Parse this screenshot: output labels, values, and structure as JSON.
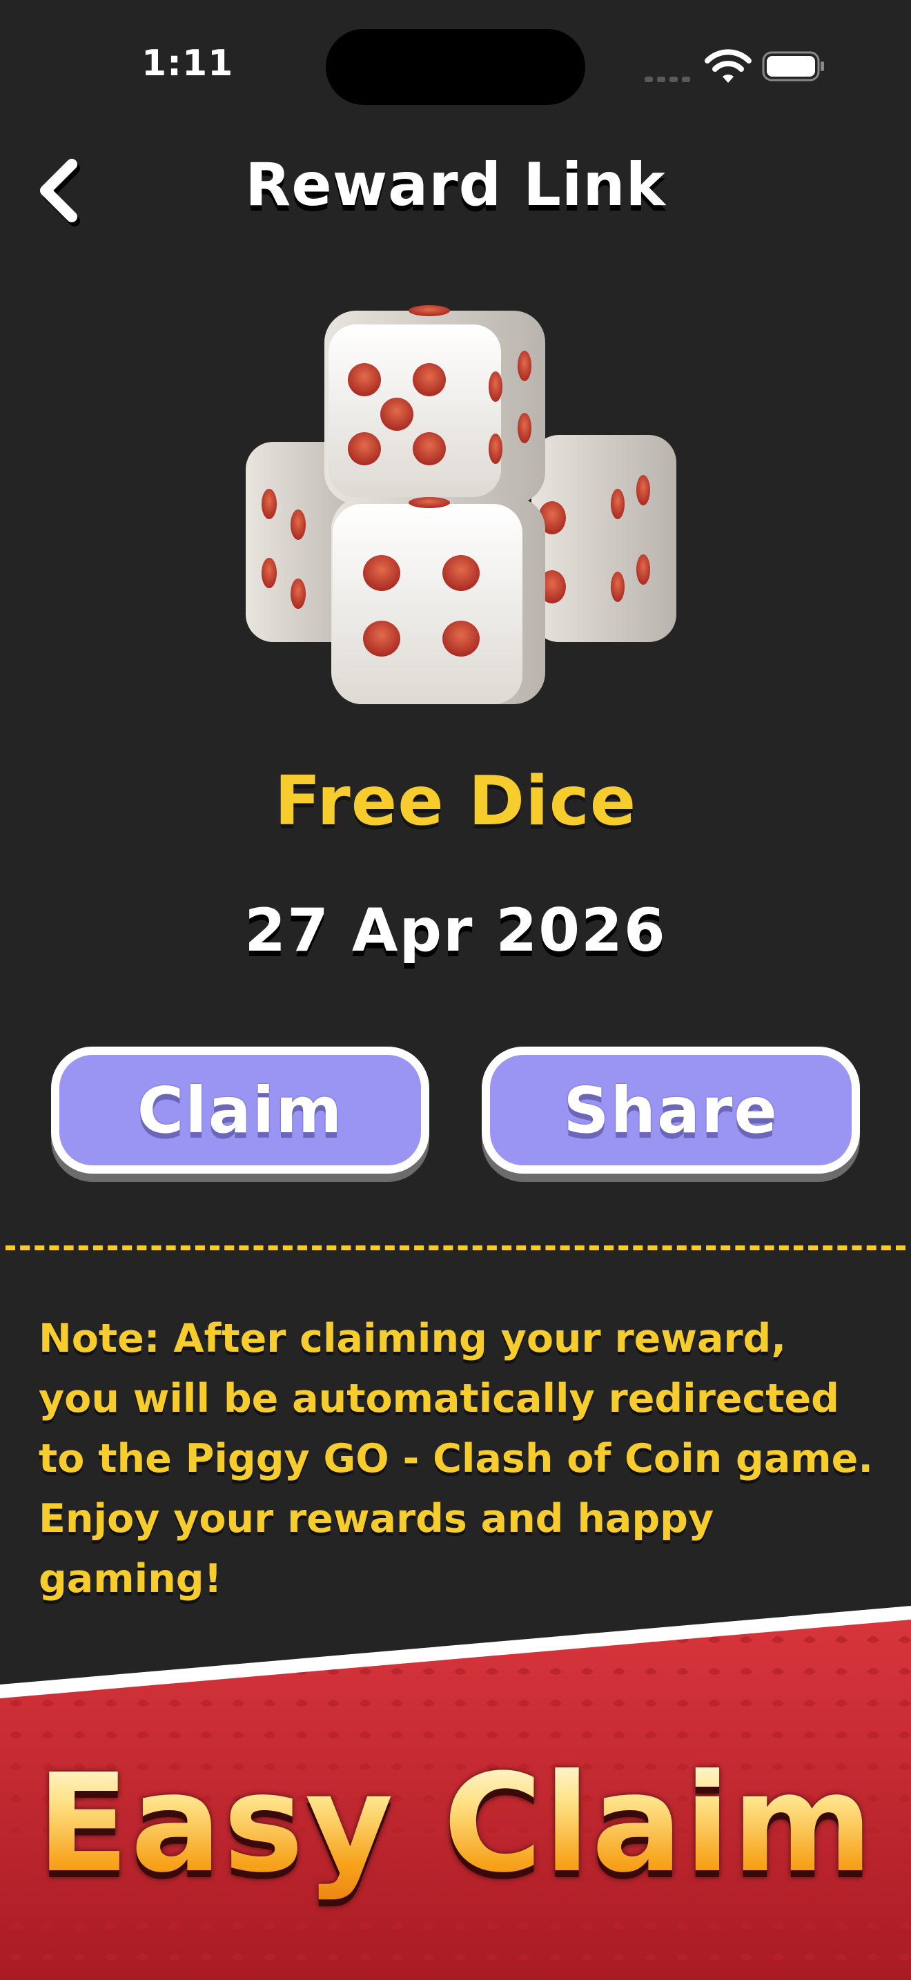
{
  "status_bar": {
    "time": "1:11"
  },
  "header": {
    "title": "Reward Link",
    "back_icon": "chevron-left-icon"
  },
  "reward": {
    "image_icon": "dice-icon",
    "name": "Free Dice",
    "date": "27 Apr 2026"
  },
  "actions": {
    "claim_label": "Claim",
    "share_label": "Share"
  },
  "note": "Note: After claiming your reward, you will be automatically redirected to the Piggy GO - Clash of Coin game. Enjoy your rewards and happy gaming!",
  "banner": {
    "text": "Easy Claim"
  },
  "colors": {
    "background": "#242424",
    "accent_yellow": "#f6cd2c",
    "button_fill": "#9a94f3",
    "banner_red": "#c2272f"
  }
}
